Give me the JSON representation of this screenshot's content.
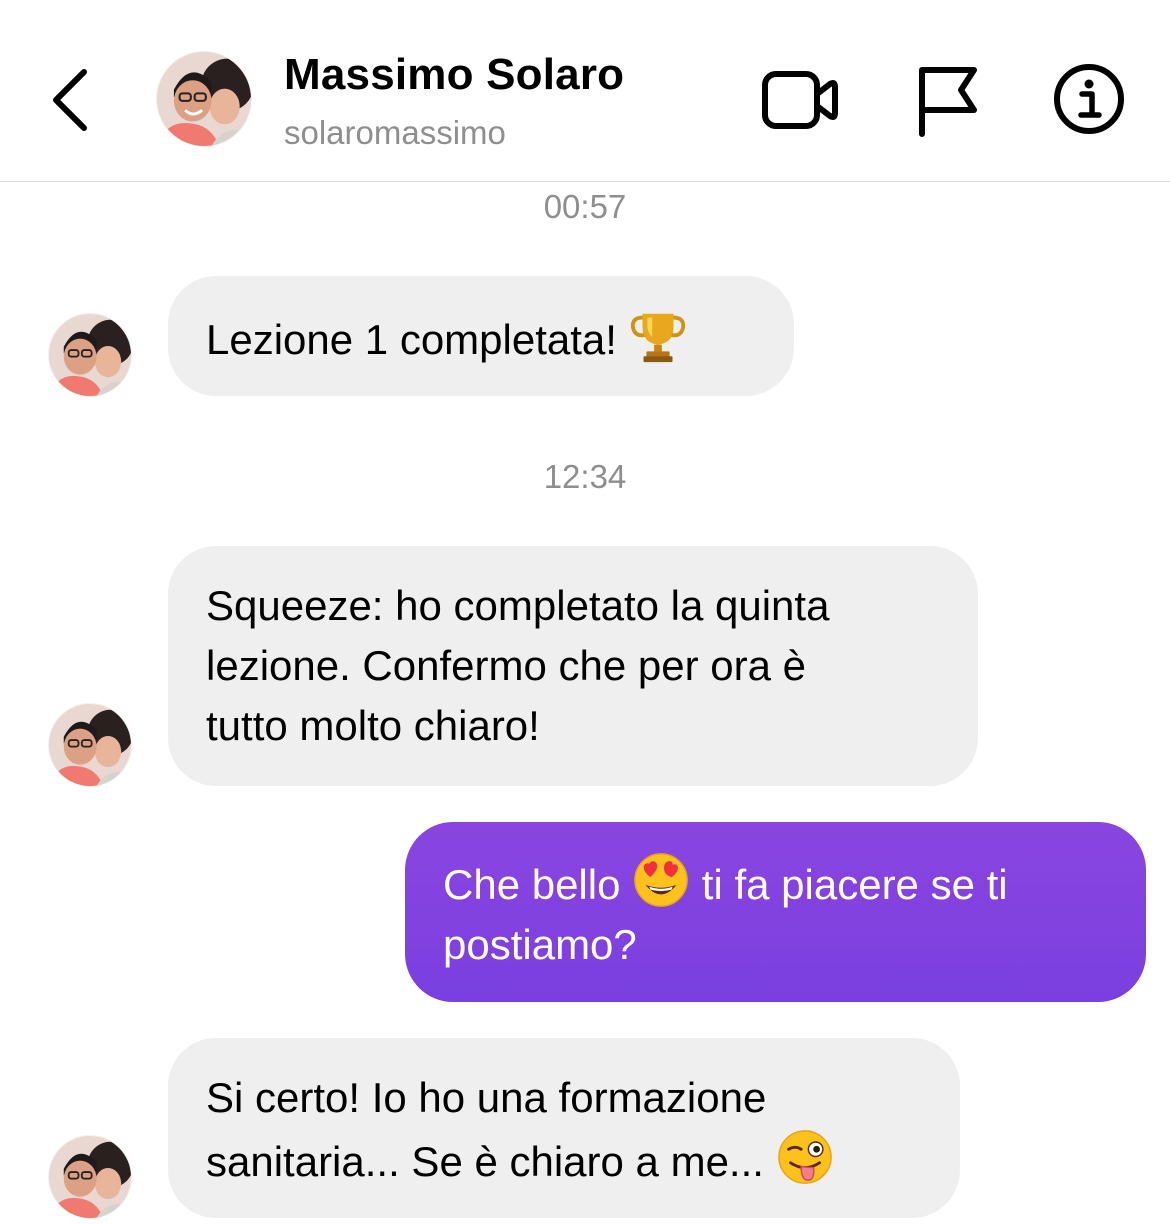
{
  "header": {
    "contact_name": "Massimo Solaro",
    "contact_username": "solaromassimo",
    "icons": {
      "back": "chevron-left-icon",
      "video": "video-camera-icon",
      "flag": "flag-icon",
      "info": "info-icon"
    }
  },
  "conversation": {
    "timestamps": [
      "00:57",
      "12:34"
    ],
    "messages": [
      {
        "from": "contact",
        "text": "Lezione 1 completata! ",
        "emoji": "trophy"
      },
      {
        "from": "contact",
        "text": "Squeeze: ho completato la quinta\nlezione. Confermo che per ora è\ntutto molto chiaro!"
      },
      {
        "from": "me",
        "text_before": "Che bello ",
        "emoji": "heart-eyes-face",
        "text_after": " ti fa piacere se ti\npostiamo?"
      },
      {
        "from": "contact",
        "text": "Si certo! Io ho una formazione\nsanitaria... Se è chiaro a me... ",
        "emoji": "winking-face-with-tongue"
      }
    ]
  },
  "colors": {
    "outgoing_bubble": "#8143e0",
    "incoming_bubble": "#efefef",
    "secondary_text": "#8e8e8e",
    "divider": "#dbdbdb"
  }
}
